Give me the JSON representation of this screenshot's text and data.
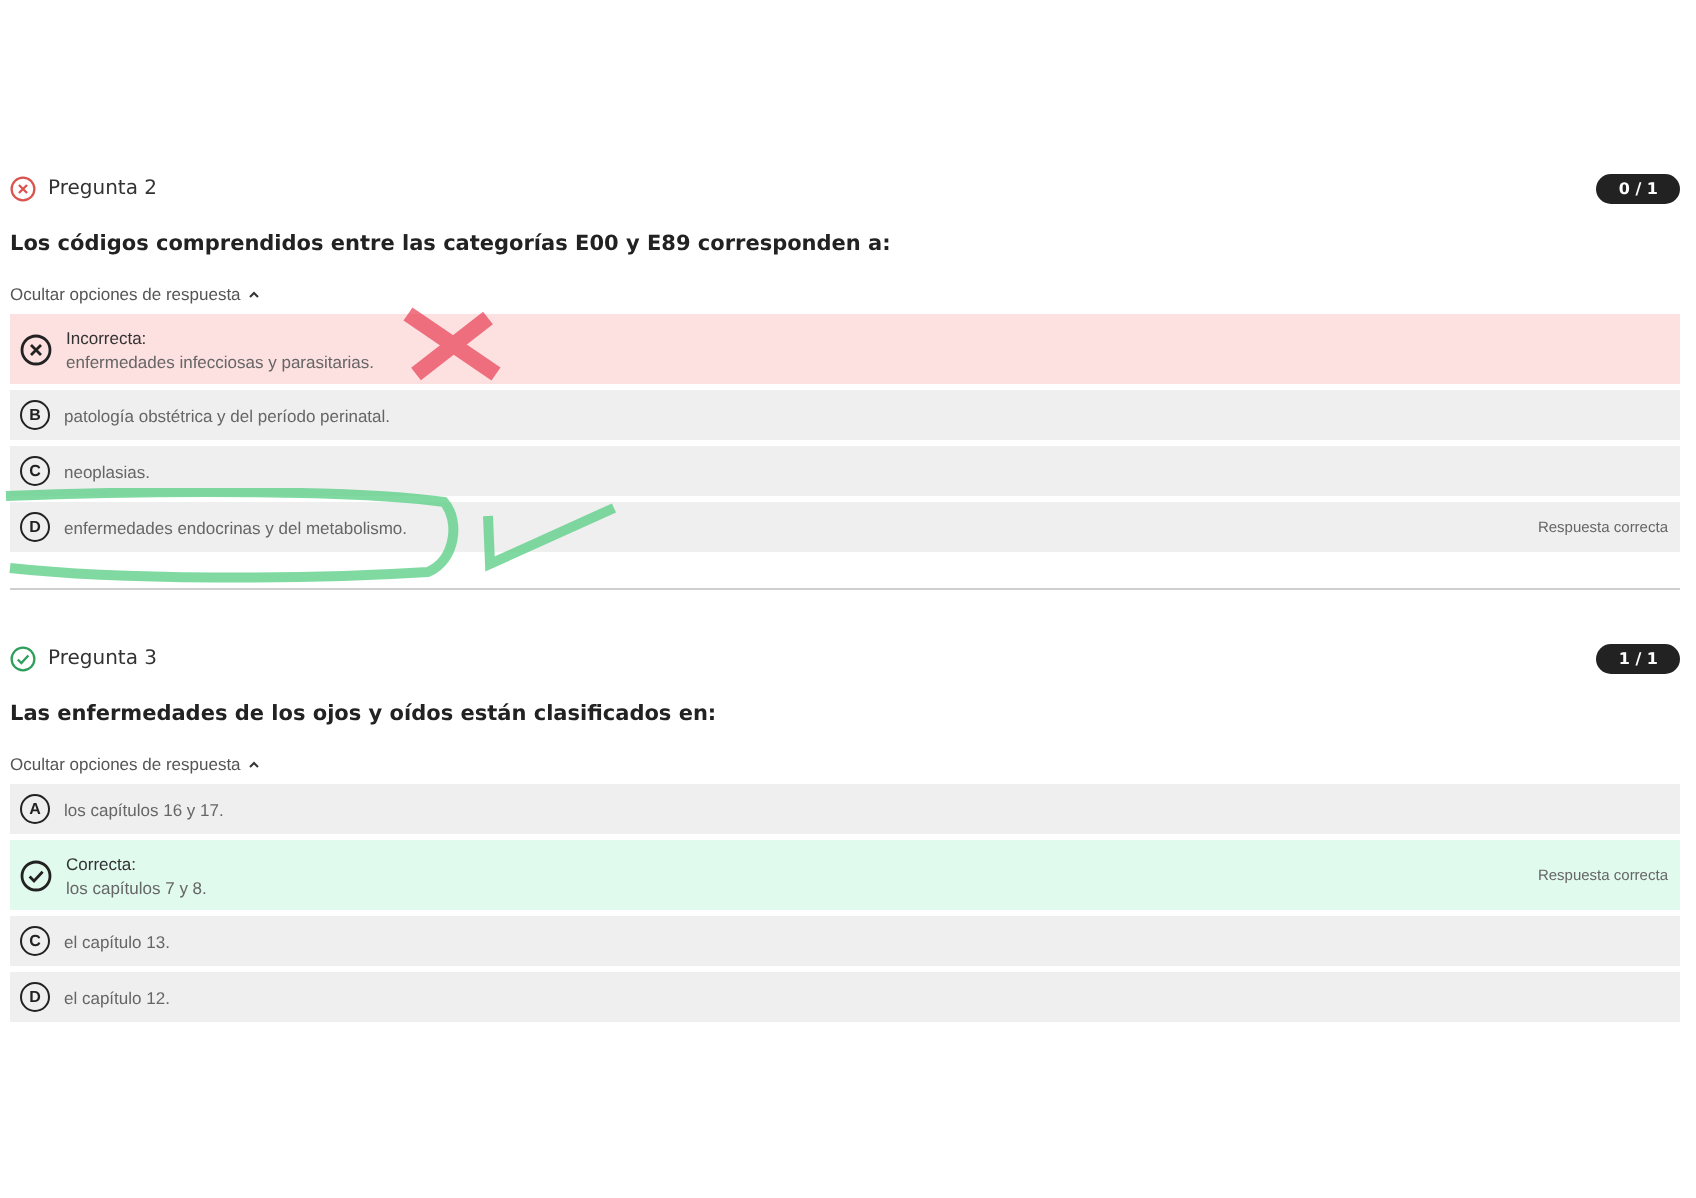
{
  "questions": [
    {
      "title": "Pregunta 2",
      "correct": false,
      "score": "0 / 1",
      "prompt": "Los códigos comprendidos entre las categorías E00 y E89 corresponden a:",
      "toggle": "Ocultar opciones de respuesta",
      "expanded": true,
      "options": [
        {
          "kind": "incorrect",
          "label": "Incorrecta:",
          "text": "enfermedades infecciosas y parasitarias.",
          "crossed": true
        },
        {
          "kind": "plain",
          "letter": "B",
          "text": "patología obstétrica y del período perinatal."
        },
        {
          "kind": "plain",
          "letter": "C",
          "text": "neoplasias."
        },
        {
          "kind": "plain",
          "letter": "D",
          "text": "enfermedades endocrinas y del metabolismo.",
          "note": "Respuesta correcta",
          "circled": true
        }
      ]
    },
    {
      "title": "Pregunta 3",
      "correct": true,
      "score": "1 / 1",
      "prompt": "Las enfermedades de los ojos y oídos están clasificados en:",
      "toggle": "Ocultar opciones de respuesta",
      "expanded": true,
      "options": [
        {
          "kind": "plain",
          "letter": "A",
          "text": "los capítulos 16 y 17."
        },
        {
          "kind": "correct",
          "label": "Correcta:",
          "text": "los capítulos 7 y 8.",
          "note": "Respuesta correcta"
        },
        {
          "kind": "plain",
          "letter": "C",
          "text": "el capítulo 13."
        },
        {
          "kind": "plain",
          "letter": "D",
          "text": "el capítulo 12."
        }
      ]
    }
  ]
}
